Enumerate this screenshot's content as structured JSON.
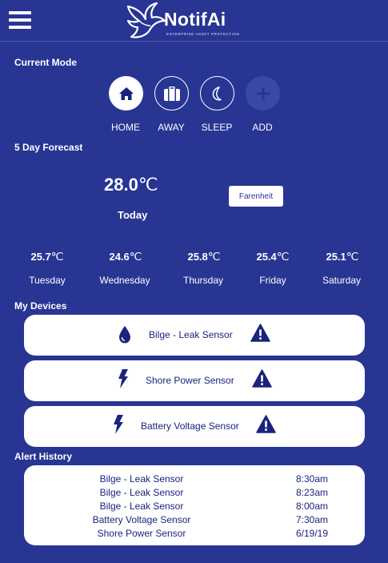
{
  "header": {
    "logo_text": "NotifAi",
    "logo_subtitle": "ENTERPRISE ASSET PROTECTION",
    "menu_icon": "hamburger-menu-icon"
  },
  "current_mode": {
    "title": "Current Mode",
    "modes": [
      {
        "label": "HOME",
        "icon": "home-icon",
        "state": "active"
      },
      {
        "label": "AWAY",
        "icon": "suitcase-icon",
        "state": "inactive"
      },
      {
        "label": "SLEEP",
        "icon": "moon-icon",
        "state": "inactive"
      },
      {
        "label": "ADD",
        "icon": "plus-icon",
        "state": "disabled"
      }
    ]
  },
  "forecast": {
    "title": "5 Day Forecast",
    "today": {
      "temp": "28.0",
      "unit": "℃",
      "label": "Today"
    },
    "unit_toggle_label": "Farenheit",
    "days": [
      {
        "temp": "25.7",
        "unit": "℃",
        "day": "Tuesday"
      },
      {
        "temp": "24.6",
        "unit": "℃",
        "day": "Wednesday"
      },
      {
        "temp": "25.8",
        "unit": "℃",
        "day": "Thursday"
      },
      {
        "temp": "25.4",
        "unit": "℃",
        "day": "Friday"
      },
      {
        "temp": "25.1",
        "unit": "℃",
        "day": "Saturday"
      }
    ]
  },
  "devices": {
    "title": "My Devices",
    "items": [
      {
        "label": "Bilge - Leak Sensor",
        "icon": "water-drop-icon",
        "status_icon": "warning-icon"
      },
      {
        "label": "Shore Power Sensor",
        "icon": "lightning-bolt-icon",
        "status_icon": "warning-icon"
      },
      {
        "label": "Battery Voltage Sensor",
        "icon": "lightning-bolt-icon",
        "status_icon": "warning-icon"
      }
    ]
  },
  "alert_history": {
    "title": "Alert History",
    "rows": [
      {
        "name": "Bilge - Leak Sensor",
        "time": "8:30am"
      },
      {
        "name": "Bilge - Leak Sensor",
        "time": "8:23am"
      },
      {
        "name": "Bilge - Leak Sensor",
        "time": "8:00am"
      },
      {
        "name": "Battery Voltage Sensor",
        "time": "7:30am"
      },
      {
        "name": "Shore Power Sensor",
        "time": "6/19/19"
      }
    ]
  },
  "colors": {
    "background": "#283593",
    "card": "#ffffff",
    "accent": "#1a237e"
  }
}
